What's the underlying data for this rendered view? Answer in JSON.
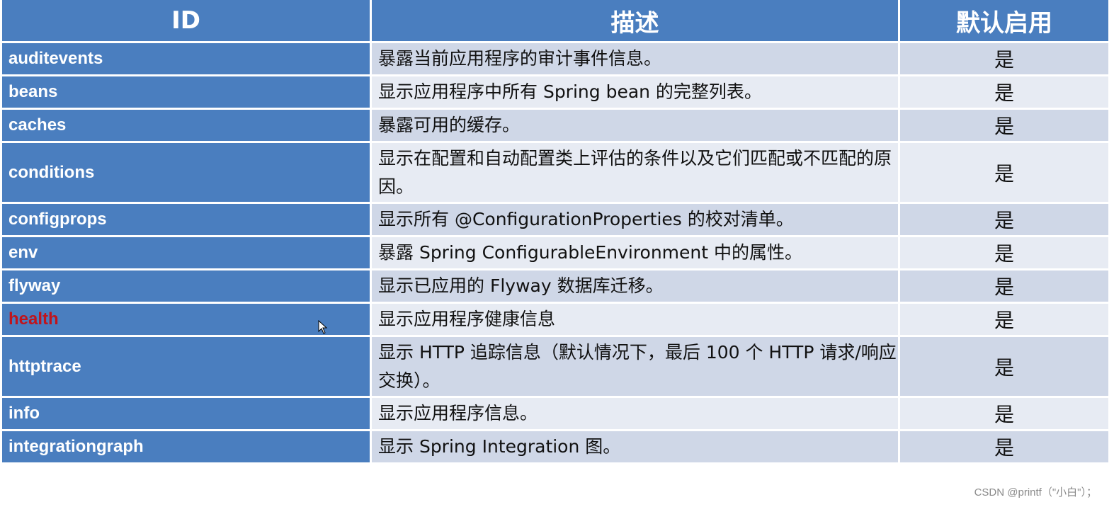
{
  "table": {
    "headers": {
      "id": "ID",
      "description": "描述",
      "default_enabled": "默认启用"
    },
    "rows": [
      {
        "id": "auditevents",
        "description": "暴露当前应用程序的审计事件信息。",
        "default_enabled": "是",
        "highlight": false,
        "lines": 1
      },
      {
        "id": "beans",
        "description": "显示应用程序中所有 Spring bean 的完整列表。",
        "default_enabled": "是",
        "highlight": false,
        "lines": 1
      },
      {
        "id": "caches",
        "description": "暴露可用的缓存。",
        "default_enabled": "是",
        "highlight": false,
        "lines": 1
      },
      {
        "id": "conditions",
        "description": "显示在配置和自动配置类上评估的条件以及它们匹配或不匹配的原因。",
        "default_enabled": "是",
        "highlight": false,
        "lines": 2
      },
      {
        "id": "configprops",
        "description": "显示所有 @ConfigurationProperties 的校对清单。",
        "default_enabled": "是",
        "highlight": false,
        "lines": 1
      },
      {
        "id": "env",
        "description": "暴露 Spring ConfigurableEnvironment 中的属性。",
        "default_enabled": "是",
        "highlight": false,
        "lines": 1
      },
      {
        "id": "flyway",
        "description": "显示已应用的 Flyway 数据库迁移。",
        "default_enabled": "是",
        "highlight": false,
        "lines": 1
      },
      {
        "id": "health",
        "description": "显示应用程序健康信息",
        "default_enabled": "是",
        "highlight": true,
        "lines": 1
      },
      {
        "id": "httptrace",
        "description": "显示 HTTP 追踪信息（默认情况下，最后 100 个 HTTP 请求/响应交换）。",
        "default_enabled": "是",
        "highlight": false,
        "lines": 2
      },
      {
        "id": "info",
        "description": "显示应用程序信息。",
        "default_enabled": "是",
        "highlight": false,
        "lines": 1
      },
      {
        "id": "integrationgraph",
        "description": "显示 Spring Integration 图。",
        "default_enabled": "是",
        "highlight": false,
        "lines": 1
      }
    ]
  },
  "colors": {
    "header_bg": "#4a7ebf",
    "highlight_text": "#c0141c",
    "row_odd": "#cfd7e7",
    "row_even": "#e7ebf3"
  },
  "watermark": "CSDN @printf（\"小白\"）；"
}
